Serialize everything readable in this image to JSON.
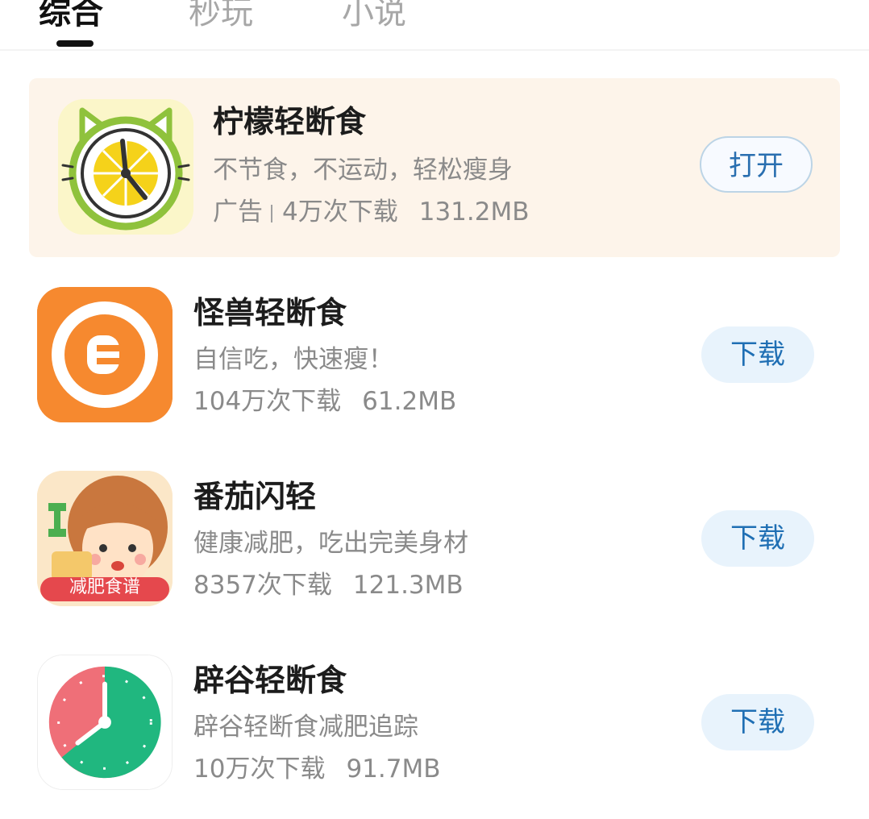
{
  "tabs": [
    {
      "label": "综合",
      "active": true
    },
    {
      "label": "秒玩",
      "active": false
    },
    {
      "label": "小说",
      "active": false
    }
  ],
  "apps": [
    {
      "name": "柠檬轻断食",
      "desc": "不节食，不运动，轻松瘦身",
      "ad_label": "广告",
      "downloads": "4万次下载",
      "size": "131.2MB",
      "button": "打开",
      "icon": "lemon-clock-icon"
    },
    {
      "name": "怪兽轻断食",
      "desc": "自信吃，快速瘦！",
      "downloads": "104万次下载",
      "size": "61.2MB",
      "button": "下载",
      "icon": "monster-e-icon"
    },
    {
      "name": "番茄闪轻",
      "desc": "健康减肥，吃出完美身材",
      "downloads": "8357次下载",
      "size": "121.3MB",
      "button": "下载",
      "icon": "girl-diet-icon",
      "icon_badge": "减肥食谱"
    },
    {
      "name": "辟谷轻断食",
      "desc": "辟谷轻断食减肥追踪",
      "downloads": "10万次下载",
      "size": "91.7MB",
      "button": "下载",
      "icon": "fasting-clock-icon"
    }
  ],
  "colors": {
    "ad_background": "#fdf4ea",
    "button_text": "#1f6fb4",
    "download_button_bg": "#e8f3fc"
  }
}
